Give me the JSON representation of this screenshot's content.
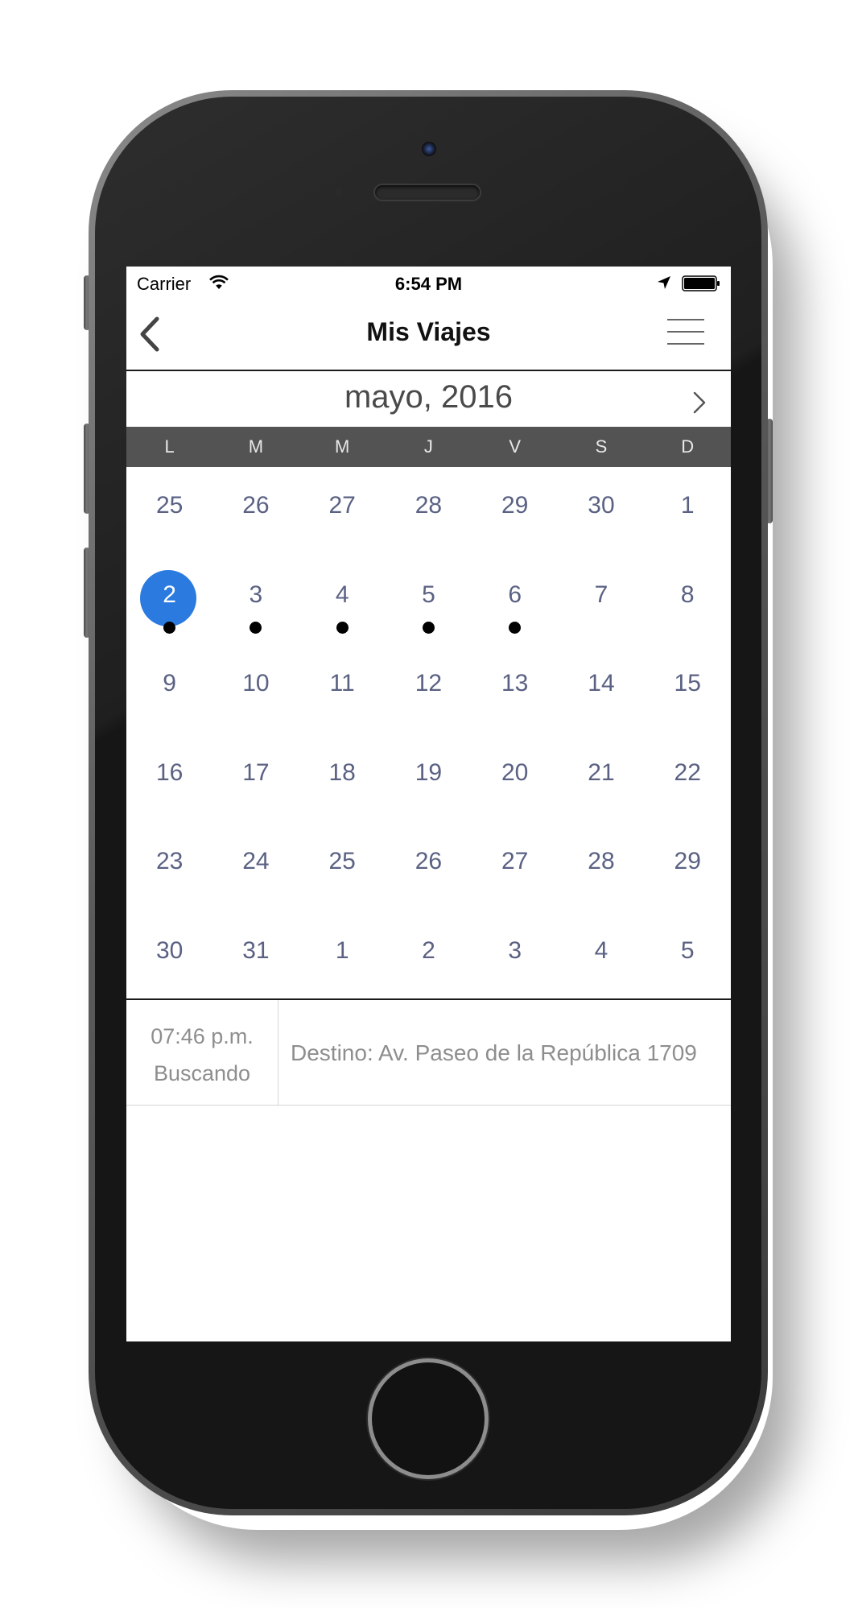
{
  "status_bar": {
    "carrier": "Carrier",
    "time": "6:54 PM"
  },
  "nav": {
    "title": "Mis Viajes",
    "back_icon": "chevron-left-icon",
    "menu_icon": "hamburger-menu-icon"
  },
  "calendar": {
    "month_label": "mayo, 2016",
    "next_icon": "chevron-right-icon",
    "weekdays": [
      "L",
      "M",
      "M",
      "J",
      "V",
      "S",
      "D"
    ],
    "weeks": [
      [
        "25",
        "26",
        "27",
        "28",
        "29",
        "30",
        "1"
      ],
      [
        "2",
        "3",
        "4",
        "5",
        "6",
        "7",
        "8"
      ],
      [
        "9",
        "10",
        "11",
        "12",
        "13",
        "14",
        "15"
      ],
      [
        "16",
        "17",
        "18",
        "19",
        "20",
        "21",
        "22"
      ],
      [
        "23",
        "24",
        "25",
        "26",
        "27",
        "28",
        "29"
      ],
      [
        "30",
        "31",
        "1",
        "2",
        "3",
        "4",
        "5"
      ]
    ],
    "selected_day": "2",
    "days_with_trips": [
      "2",
      "3",
      "4",
      "5",
      "6"
    ],
    "colors": {
      "selected": "#2a7ae0",
      "day_text": "#5a6183",
      "weekday_bar": "#535353"
    }
  },
  "trips": [
    {
      "time": "07:46 p.m.",
      "status": "Buscando",
      "destination": "Destino: Av. Paseo de la República 1709"
    }
  ]
}
